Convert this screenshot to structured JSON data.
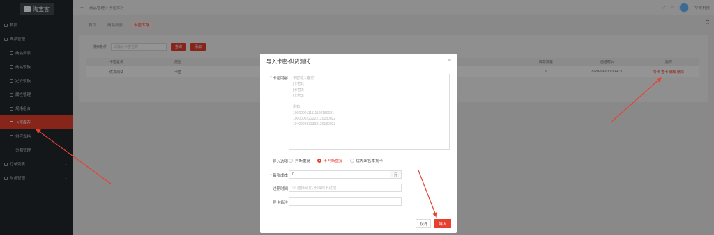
{
  "sidebar": {
    "logo": "淘宝客",
    "items": [
      {
        "label": "首页",
        "sub": false,
        "chev": ""
      },
      {
        "label": "商品管理",
        "sub": false,
        "chev": "⌃"
      },
      {
        "label": "商品列表",
        "sub": true,
        "chev": ""
      },
      {
        "label": "商品模板",
        "sub": true,
        "chev": ""
      },
      {
        "label": "定价模板",
        "sub": true,
        "chev": ""
      },
      {
        "label": "属性管理",
        "sub": true,
        "chev": ""
      },
      {
        "label": "规格组合",
        "sub": true,
        "chev": ""
      },
      {
        "label": "卡密库存",
        "sub": true,
        "chev": "",
        "active": true
      },
      {
        "label": "供应规格",
        "sub": true,
        "chev": ""
      },
      {
        "label": "分期管理",
        "sub": true,
        "chev": ""
      },
      {
        "label": "订单列表",
        "sub": false,
        "chev": "⌄"
      },
      {
        "label": "财务管理",
        "sub": false,
        "chev": "⌄"
      }
    ]
  },
  "header": {
    "breadcrumb_root": "商品管理",
    "breadcrumb_sep": ">",
    "breadcrumb_current": "卡密库存",
    "user_name": "华贸科技"
  },
  "tabs": [
    "首页",
    "商品列表",
    "卡密库存"
  ],
  "search": {
    "label": "搜索条件",
    "placeholder": "请输入卡密名称",
    "search_button": "查询",
    "add_button": "添加"
  },
  "table": {
    "columns": [
      "卡密名称",
      "类型",
      "",
      "",
      "",
      "",
      "",
      "库存数量",
      "创建时间",
      "操作"
    ],
    "row": [
      "供货测试",
      "卡密",
      "",
      "",
      "",
      "",
      "",
      "0",
      "2020-09-03 00:44:10",
      "导卡 查卡 编辑 删除"
    ]
  },
  "modal": {
    "title": "导入卡密-供货测试",
    "close": "×",
    "content_label": "卡密内容",
    "textarea_lines": [
      "卡密导入格式：",
      "[卡密1]",
      "[卡密2]",
      "[卡密3]",
      "",
      "例如：",
      "1000000111111120189021",
      "1000000222222120180022",
      "1040992333333120180023"
    ],
    "import_option_label": "导入选项",
    "options": [
      "判断重复",
      "不判断重复",
      "优先出售本批卡"
    ],
    "selected_option": "不判断重复",
    "cost_label": "每张成本",
    "cost_value": "0",
    "cost_suffix": "元",
    "expire_label": "过期时间",
    "expire_placeholder": "选择日期,不填则不过期",
    "remark_label": "导卡备注",
    "remark_value": "",
    "cancel": "取消",
    "import": "导入"
  },
  "colors": {
    "accent": "#e8402f",
    "sidebar_bg": "#23282e",
    "arrow": "#e8402f"
  }
}
